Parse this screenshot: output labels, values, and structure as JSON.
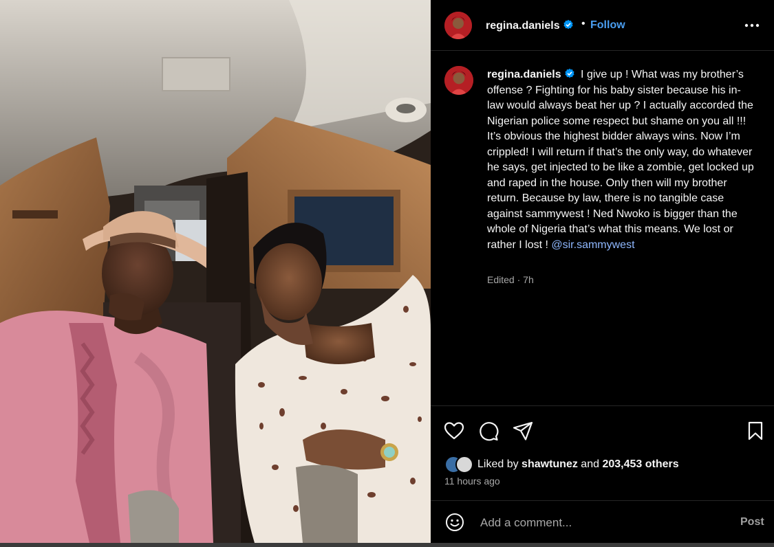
{
  "post": {
    "username": "regina.daniels",
    "verified": true,
    "follow_label": "Follow",
    "separator": "•",
    "caption_user": "regina.daniels",
    "caption_text": "I give up ! What was my brother’s offense ? Fighting for his baby sister because his in-law would always beat her up ? I actually accorded the Nigerian police some respect but shame on you all !!! It’s obvious the highest bidder always wins. Now I’m crippled! I will return if that’s the only way, do whatever he says, get injected to be like a zombie, get locked up and raped in the house. Only then will my brother return. Because by law, there is no tangible case against sammywest ! Ned Nwoko is bigger than the whole of Nigeria that’s what this means. We lost or rather I lost !",
    "caption_mention": "@sir.sammywest",
    "edited_label": "Edited",
    "edited_sep": "·",
    "edited_time": "7h",
    "liked_by_prefix": "Liked by",
    "liked_by_user": "shawtunez",
    "liked_by_and": "and",
    "liked_by_others": "203,453 others",
    "time_ago": "11 hours ago"
  },
  "comment": {
    "placeholder": "Add a comment...",
    "post_label": "Post"
  },
  "icons": {
    "more": "more-horizontal-icon",
    "like": "heart-icon",
    "comment": "comment-bubble-icon",
    "share": "paper-plane-icon",
    "save": "bookmark-icon",
    "emoji": "smiley-face-icon",
    "verified": "verified-badge-icon"
  },
  "colors": {
    "background": "#000000",
    "text": "#f5f5f5",
    "muted": "#a8a8a8",
    "link": "#4a9ef0",
    "mention": "#8fb8ff",
    "verified": "#0095f6"
  }
}
